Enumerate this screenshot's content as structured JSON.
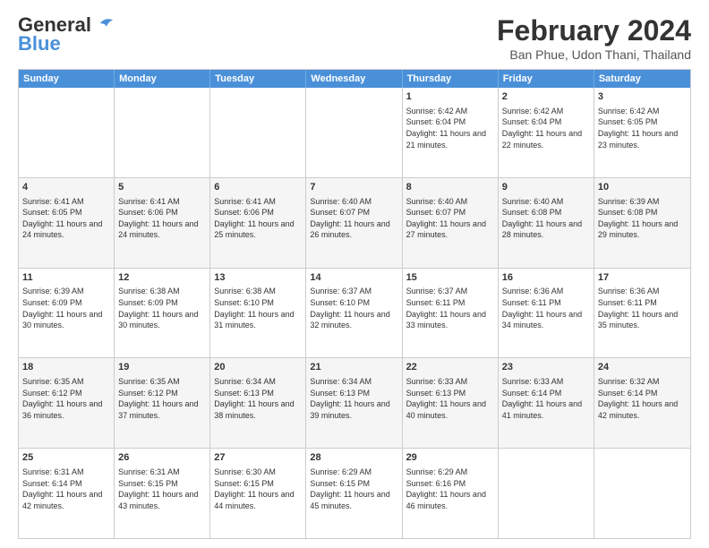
{
  "header": {
    "logo_line1": "General",
    "logo_line2": "Blue",
    "month_year": "February 2024",
    "location": "Ban Phue, Udon Thani, Thailand"
  },
  "days_of_week": [
    "Sunday",
    "Monday",
    "Tuesday",
    "Wednesday",
    "Thursday",
    "Friday",
    "Saturday"
  ],
  "rows": [
    {
      "alt": false,
      "cells": [
        {
          "day": "",
          "text": ""
        },
        {
          "day": "",
          "text": ""
        },
        {
          "day": "",
          "text": ""
        },
        {
          "day": "",
          "text": ""
        },
        {
          "day": "1",
          "text": "Sunrise: 6:42 AM\nSunset: 6:04 PM\nDaylight: 11 hours and 21 minutes."
        },
        {
          "day": "2",
          "text": "Sunrise: 6:42 AM\nSunset: 6:04 PM\nDaylight: 11 hours and 22 minutes."
        },
        {
          "day": "3",
          "text": "Sunrise: 6:42 AM\nSunset: 6:05 PM\nDaylight: 11 hours and 23 minutes."
        }
      ]
    },
    {
      "alt": true,
      "cells": [
        {
          "day": "4",
          "text": "Sunrise: 6:41 AM\nSunset: 6:05 PM\nDaylight: 11 hours and 24 minutes."
        },
        {
          "day": "5",
          "text": "Sunrise: 6:41 AM\nSunset: 6:06 PM\nDaylight: 11 hours and 24 minutes."
        },
        {
          "day": "6",
          "text": "Sunrise: 6:41 AM\nSunset: 6:06 PM\nDaylight: 11 hours and 25 minutes."
        },
        {
          "day": "7",
          "text": "Sunrise: 6:40 AM\nSunset: 6:07 PM\nDaylight: 11 hours and 26 minutes."
        },
        {
          "day": "8",
          "text": "Sunrise: 6:40 AM\nSunset: 6:07 PM\nDaylight: 11 hours and 27 minutes."
        },
        {
          "day": "9",
          "text": "Sunrise: 6:40 AM\nSunset: 6:08 PM\nDaylight: 11 hours and 28 minutes."
        },
        {
          "day": "10",
          "text": "Sunrise: 6:39 AM\nSunset: 6:08 PM\nDaylight: 11 hours and 29 minutes."
        }
      ]
    },
    {
      "alt": false,
      "cells": [
        {
          "day": "11",
          "text": "Sunrise: 6:39 AM\nSunset: 6:09 PM\nDaylight: 11 hours and 30 minutes."
        },
        {
          "day": "12",
          "text": "Sunrise: 6:38 AM\nSunset: 6:09 PM\nDaylight: 11 hours and 30 minutes."
        },
        {
          "day": "13",
          "text": "Sunrise: 6:38 AM\nSunset: 6:10 PM\nDaylight: 11 hours and 31 minutes."
        },
        {
          "day": "14",
          "text": "Sunrise: 6:37 AM\nSunset: 6:10 PM\nDaylight: 11 hours and 32 minutes."
        },
        {
          "day": "15",
          "text": "Sunrise: 6:37 AM\nSunset: 6:11 PM\nDaylight: 11 hours and 33 minutes."
        },
        {
          "day": "16",
          "text": "Sunrise: 6:36 AM\nSunset: 6:11 PM\nDaylight: 11 hours and 34 minutes."
        },
        {
          "day": "17",
          "text": "Sunrise: 6:36 AM\nSunset: 6:11 PM\nDaylight: 11 hours and 35 minutes."
        }
      ]
    },
    {
      "alt": true,
      "cells": [
        {
          "day": "18",
          "text": "Sunrise: 6:35 AM\nSunset: 6:12 PM\nDaylight: 11 hours and 36 minutes."
        },
        {
          "day": "19",
          "text": "Sunrise: 6:35 AM\nSunset: 6:12 PM\nDaylight: 11 hours and 37 minutes."
        },
        {
          "day": "20",
          "text": "Sunrise: 6:34 AM\nSunset: 6:13 PM\nDaylight: 11 hours and 38 minutes."
        },
        {
          "day": "21",
          "text": "Sunrise: 6:34 AM\nSunset: 6:13 PM\nDaylight: 11 hours and 39 minutes."
        },
        {
          "day": "22",
          "text": "Sunrise: 6:33 AM\nSunset: 6:13 PM\nDaylight: 11 hours and 40 minutes."
        },
        {
          "day": "23",
          "text": "Sunrise: 6:33 AM\nSunset: 6:14 PM\nDaylight: 11 hours and 41 minutes."
        },
        {
          "day": "24",
          "text": "Sunrise: 6:32 AM\nSunset: 6:14 PM\nDaylight: 11 hours and 42 minutes."
        }
      ]
    },
    {
      "alt": false,
      "cells": [
        {
          "day": "25",
          "text": "Sunrise: 6:31 AM\nSunset: 6:14 PM\nDaylight: 11 hours and 42 minutes."
        },
        {
          "day": "26",
          "text": "Sunrise: 6:31 AM\nSunset: 6:15 PM\nDaylight: 11 hours and 43 minutes."
        },
        {
          "day": "27",
          "text": "Sunrise: 6:30 AM\nSunset: 6:15 PM\nDaylight: 11 hours and 44 minutes."
        },
        {
          "day": "28",
          "text": "Sunrise: 6:29 AM\nSunset: 6:15 PM\nDaylight: 11 hours and 45 minutes."
        },
        {
          "day": "29",
          "text": "Sunrise: 6:29 AM\nSunset: 6:16 PM\nDaylight: 11 hours and 46 minutes."
        },
        {
          "day": "",
          "text": ""
        },
        {
          "day": "",
          "text": ""
        }
      ]
    }
  ]
}
